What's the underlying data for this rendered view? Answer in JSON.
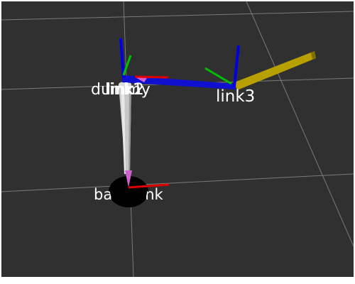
{
  "viewport": {
    "background": "#303030",
    "grid_color": "#9a9a9a"
  },
  "frames": {
    "dummy": "dummy",
    "link1": "link1",
    "link2": "link2",
    "link3": "link3",
    "base_link": "base_link"
  },
  "colors": {
    "x_axis": "#e00000",
    "y_axis": "#00c000",
    "z_axis": "#0000e0",
    "link_gray": "#c8c8c8",
    "link_blue": "#1010d0",
    "link_yellow": "#b8a000",
    "base_disc": "#000000",
    "joint_marker": "#d060d0"
  }
}
